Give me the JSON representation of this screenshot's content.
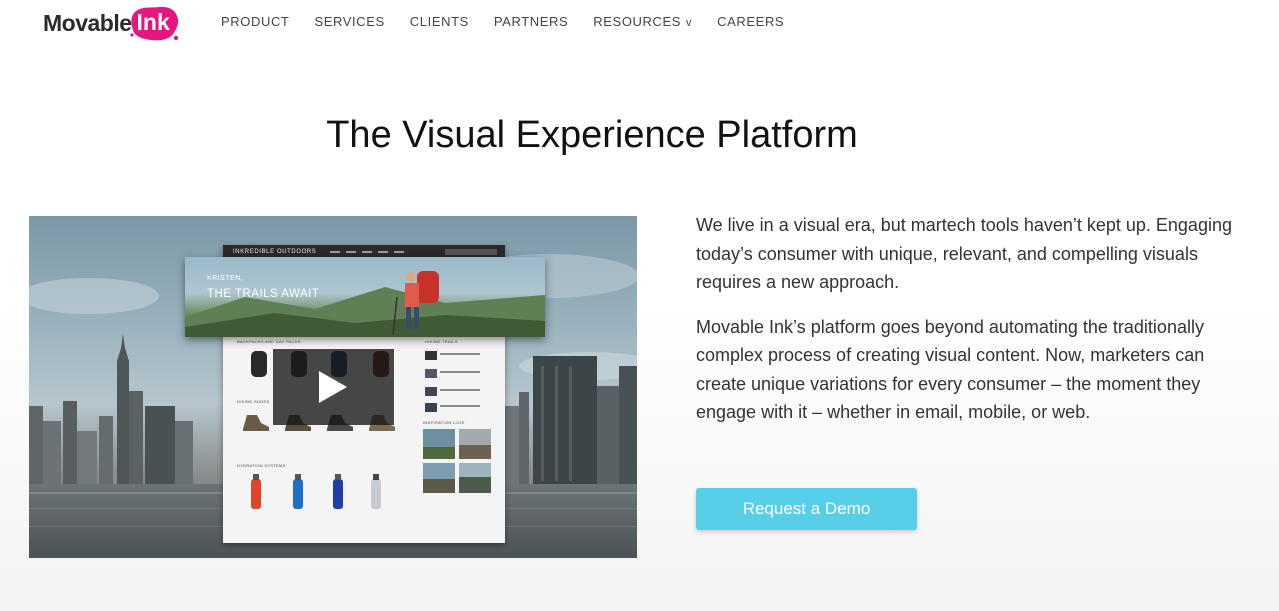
{
  "header": {
    "logo": {
      "part1": "Movable",
      "part2": "Ink",
      "accent_color": "#e5177e"
    },
    "nav": [
      {
        "label": "PRODUCT"
      },
      {
        "label": "SERVICES"
      },
      {
        "label": "CLIENTS"
      },
      {
        "label": "PARTNERS"
      },
      {
        "label": "RESOURCES",
        "dropdown_glyph": "v"
      },
      {
        "label": "CAREERS"
      }
    ]
  },
  "hero": {
    "title": "The Visual Experience Platform"
  },
  "video": {
    "play_icon": "play-icon",
    "mock_site": {
      "brand": "INKREDIBLE OUTDOORS",
      "hero_name": "KRISTEN,",
      "hero_tagline": "THE TRAILS AWAIT",
      "sections": [
        "BACKPACKS AND DAY PACKS",
        "HIKING SHOES",
        "HYDRATION SYSTEMS",
        "HIKING TRAILS",
        "INSPIRATION LOVE"
      ]
    }
  },
  "copy": {
    "paragraph_1": "We live in a visual era, but martech tools haven’t kept up. Engaging today’s consumer with unique, relevant, and compelling visuals requires a new approach.",
    "paragraph_2": "Movable Ink’s platform goes beyond automating the traditionally complex process of creating visual content. Now, marketers can create unique variations for every consumer – the moment they engage with it – whether in email, mobile, or web."
  },
  "cta": {
    "label": "Request a Demo",
    "color": "#57cfe8"
  }
}
